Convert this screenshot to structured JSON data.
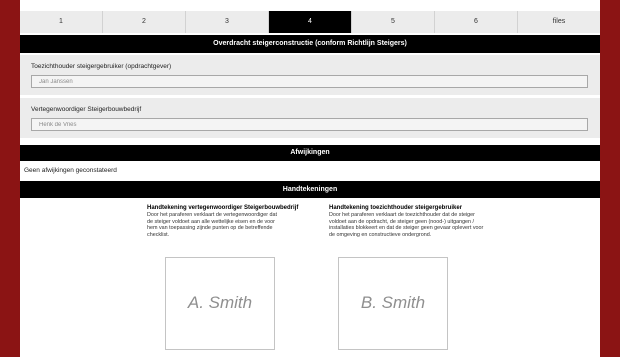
{
  "tabs": [
    {
      "label": "1"
    },
    {
      "label": "2"
    },
    {
      "label": "3"
    },
    {
      "label": "4"
    },
    {
      "label": "5"
    },
    {
      "label": "6"
    },
    {
      "label": "files"
    }
  ],
  "active_tab": "4",
  "overdracht": {
    "title": "Overdracht steigerconstructie (conform Richtlijn Steigers)",
    "toezichthouder": {
      "label": "Toezichthouder steigergebruiker (opdrachtgever)",
      "value": "Jan Janssen"
    },
    "vertegenwoordiger": {
      "label": "Vertegenwoordiger Steigerbouwbedrijf",
      "value": "Henk de Vries"
    }
  },
  "afwijkingen": {
    "title": "Afwijkingen",
    "text": "Geen afwijkingen geconstateerd"
  },
  "handtekeningen": {
    "title": "Handtekeningen",
    "left": {
      "title": "Handtekening vertegenwoordiger Steigerbouwbedrijf",
      "text": "Door het paraferen verklaart de vertegenwoordiger dat de steiger voldoet aan alle wettelijke eisen en de voor hem van toepassing zijnde punten op de betreffende checklist.",
      "signature": "A. Smith"
    },
    "right": {
      "title": "Handtekening toezichthouder steigergebruiker",
      "text": "Door het paraferen verklaart de toezichthouder dat de steiger voldoet aan de opdracht, de steiger geen (nood-) uitgangen / installaties blokkeert en dat de steiger geen gevaar oplevert voor de omgeving en constructieve ondergrond.",
      "signature": "B. Smith"
    }
  },
  "colors": {
    "frame": "#8b1414",
    "bar": "#000000",
    "field_bg": "#ececec"
  }
}
